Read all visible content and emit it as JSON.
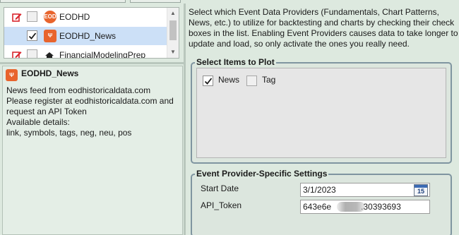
{
  "providers": [
    {
      "label": "EODHD",
      "checked": false,
      "logo_text": "EOD",
      "logo_color": "#e8642d"
    },
    {
      "label": "EODHD_News",
      "checked": true,
      "logo_text": "Ψ",
      "logo_color": "#e8642d",
      "selected": true
    },
    {
      "label": "FinancialModelingPrep",
      "checked": false,
      "logo_text": "",
      "logo_color": "#222222"
    }
  ],
  "detail": {
    "title": "EODHD_News",
    "lines": [
      "News feed from eodhistoricaldata.com",
      "Please register at eodhistoricaldata.com and",
      "request an API Token",
      "Available details:",
      "link, symbols, tags, neg, neu, pos"
    ]
  },
  "intro_lines": [
    "Select which Event Data Providers (Fundamentals, Chart Patterns,",
    "News, etc.) to utilize for backtesting and charts by checking their check",
    "boxes in the list. Enabling Event Providers causes data to take longer to",
    "update and load, so only activate the ones you really need."
  ],
  "plot_items": {
    "title": "Select Items to Plot",
    "items": [
      {
        "label": "News",
        "checked": true
      },
      {
        "label": "Tag",
        "checked": false
      }
    ]
  },
  "settings": {
    "title": "Event Provider-Specific Settings",
    "start_date_label": "Start Date",
    "start_date_value": "3/1/2023",
    "calendar_day": "15",
    "api_token_label": "API_Token",
    "api_token_prefix": "643e6e",
    "api_token_suffix": ".30393693"
  },
  "colors": {
    "background": "#dde9df",
    "selection": "#cce0f7",
    "groupbox_border": "#7f95a0",
    "edit_icon": "#d9262d"
  },
  "icons": [
    "edit-pencil-icon",
    "provider-logo-icon",
    "calendar-icon",
    "scroll-up-icon",
    "scroll-down-icon"
  ]
}
